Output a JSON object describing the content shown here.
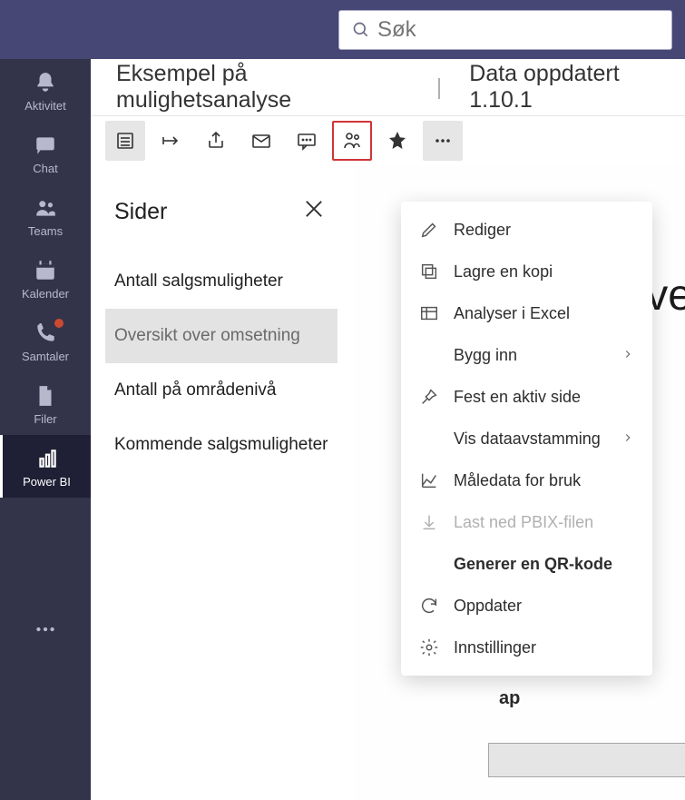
{
  "search": {
    "placeholder": "Søk"
  },
  "rail": {
    "items": [
      {
        "label": "Aktivitet"
      },
      {
        "label": "Chat"
      },
      {
        "label": "Teams"
      },
      {
        "label": "Kalender"
      },
      {
        "label": "Samtaler"
      },
      {
        "label": "Filer"
      },
      {
        "label": "Power BI"
      }
    ]
  },
  "header": {
    "title": "Eksempel på mulighetsanalyse",
    "divider": "|",
    "updated": "Data oppdatert 1.10.1"
  },
  "pages": {
    "title": "Sider",
    "items": [
      "Antall salgsmuligheter",
      "Oversikt over omsetning",
      "Antall på områdenivå",
      "Kommende salgsmuligheter"
    ]
  },
  "canvas": {
    "right_word_fragment": "ve",
    "mid_word_fragment": "Reve",
    "ap_prefix": "ap"
  },
  "menu": {
    "items": [
      {
        "label": "Rediger"
      },
      {
        "label": "Lagre en kopi"
      },
      {
        "label": "Analyser i Excel"
      },
      {
        "label": "Bygg inn"
      },
      {
        "label": "Fest en aktiv side"
      },
      {
        "label": "Vis dataavstamming"
      },
      {
        "label": "Måledata for bruk"
      },
      {
        "label": "Last ned PBIX-filen"
      },
      {
        "label": "Generer en QR-kode"
      },
      {
        "label": "Oppdater"
      },
      {
        "label": "Innstillinger"
      }
    ]
  }
}
